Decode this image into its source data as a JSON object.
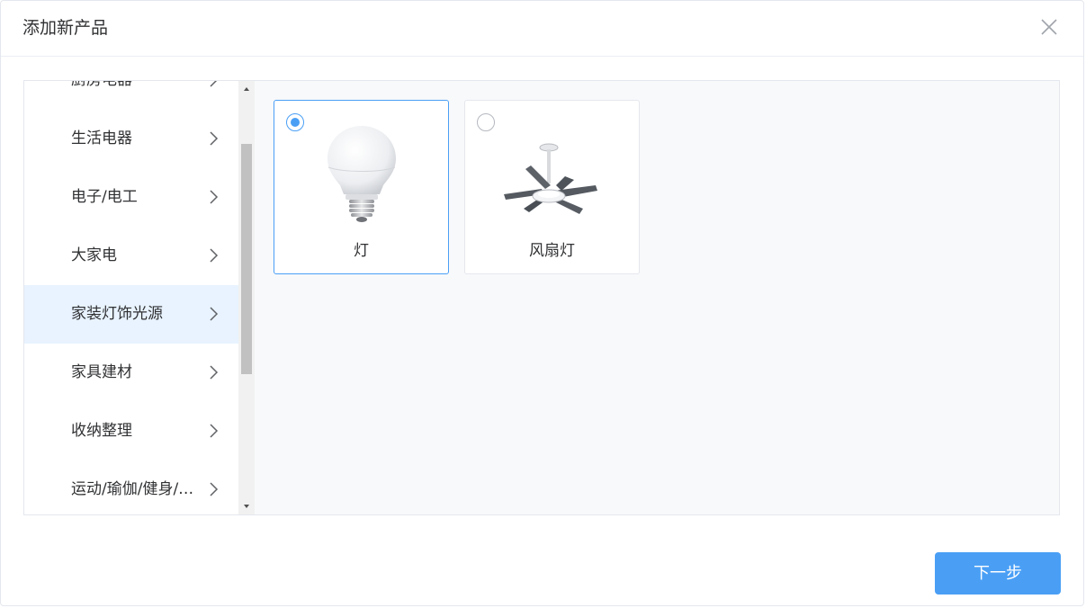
{
  "dialog": {
    "title": "添加新产品",
    "close_icon": "close-icon"
  },
  "categories": {
    "items": [
      {
        "label": "厨房电器",
        "active": false
      },
      {
        "label": "生活电器",
        "active": false
      },
      {
        "label": "电子/电工",
        "active": false
      },
      {
        "label": "大家电",
        "active": false
      },
      {
        "label": "家装灯饰光源",
        "active": true
      },
      {
        "label": "家具建材",
        "active": false
      },
      {
        "label": "收纳整理",
        "active": false
      },
      {
        "label": "运动/瑜伽/健身/…",
        "active": false
      }
    ],
    "arrow_icon": "chevron-right-icon"
  },
  "products": {
    "items": [
      {
        "name": "灯",
        "selected": true,
        "icon": "light-bulb-icon"
      },
      {
        "name": "风扇灯",
        "selected": false,
        "icon": "ceiling-fan-light-icon"
      }
    ]
  },
  "footer": {
    "next_label": "下一步"
  },
  "colors": {
    "accent": "#4a9ff5",
    "active_bg": "#e8f3ff",
    "panel_bg": "#f8f9fb"
  }
}
